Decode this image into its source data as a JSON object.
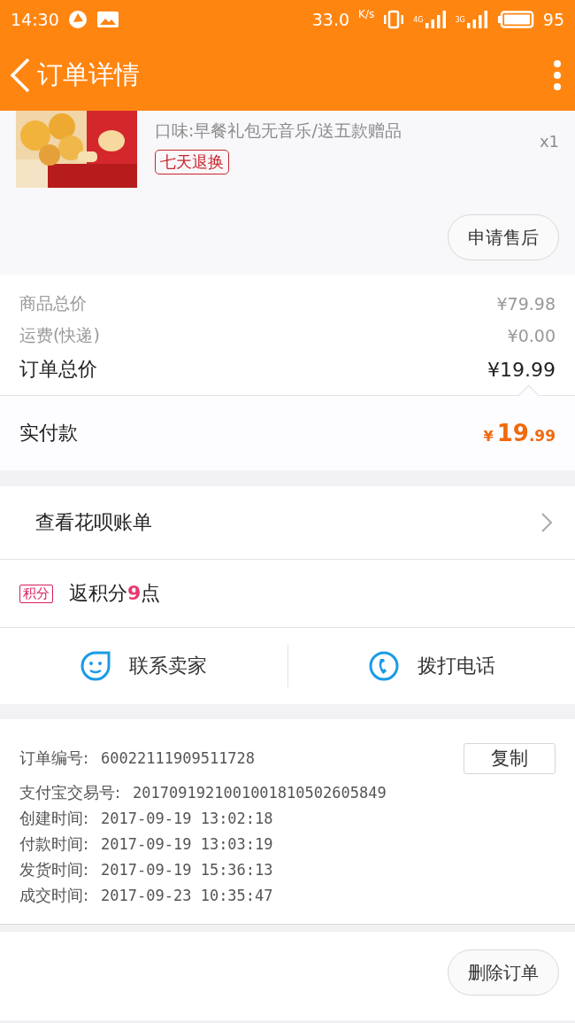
{
  "status_bar": {
    "time": "14:30",
    "speed": "33.0",
    "speed_unit": "K/s",
    "signal_1_label": "4G",
    "signal_2_label": "3G",
    "battery": "95"
  },
  "header": {
    "title": "订单详情"
  },
  "product": {
    "kind": "picture",
    "option": "口味:早餐礼包无音乐/送五款赠品",
    "quantity": "x1",
    "tag": "七天退换",
    "after_sale_button": "申请售后"
  },
  "prices": [
    {
      "label": "商品总价",
      "value": "¥79.98",
      "kind": "minor"
    },
    {
      "label": "运费(快递)",
      "value": "¥0.00",
      "kind": "minor"
    },
    {
      "label": "订单总价",
      "value": "¥19.99",
      "kind": "total"
    }
  ],
  "paid": {
    "label": "实付款",
    "currency": "¥",
    "integer": "19",
    "decimal": ".99"
  },
  "bill_link": "查看花呗账单",
  "points": {
    "badge": "积分",
    "prefix": "返积分",
    "count": "9",
    "suffix": "点"
  },
  "contacts": [
    {
      "kind": "chat",
      "label": "联系卖家"
    },
    {
      "kind": "phone",
      "label": "拨打电话"
    }
  ],
  "order_info": [
    {
      "label": "订单编号:",
      "value": "60022111909511728",
      "copy_button": "复制"
    },
    {
      "label": "支付宝交易号:",
      "value": "2017091921001001810502605849"
    },
    {
      "label": "创建时间:",
      "value": "2017-09-19 13:02:18"
    },
    {
      "label": "付款时间:",
      "value": "2017-09-19 13:03:19"
    },
    {
      "label": "发货时间:",
      "value": "2017-09-19 15:36:13"
    },
    {
      "label": "成交时间:",
      "value": "2017-09-23 10:35:47"
    }
  ],
  "delete_button": "删除订单"
}
